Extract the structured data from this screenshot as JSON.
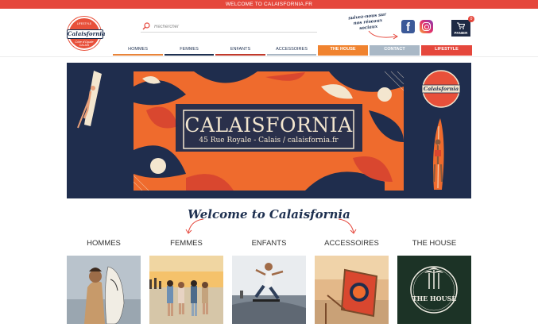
{
  "topbar": {
    "text": "WELCOME TO CALAISFORNIA.FR"
  },
  "logo": {
    "top": "LIFESTYLE",
    "name": "Calaisfornia",
    "sub": "Côte d'Opale",
    "bottom": "CALAIS"
  },
  "search": {
    "placeholder": "Rechercher"
  },
  "social": {
    "text": "suivez-nous sur nos réseaux sociaux",
    "facebook": "f"
  },
  "cart": {
    "label": "PANIER",
    "count": "0"
  },
  "nav": [
    {
      "label": "HOMMES",
      "color": "#e8843a",
      "style": "under"
    },
    {
      "label": "FEMMES",
      "color": "#1e3050",
      "style": "under"
    },
    {
      "label": "ENFANTS",
      "color": "#c0392b",
      "style": "under"
    },
    {
      "label": "ACCESSOIRES",
      "color": "#aab7c4",
      "style": "under"
    },
    {
      "label": "THE HOUSE",
      "color": "#f0832f",
      "style": "filled"
    },
    {
      "label": "CONTACT",
      "color": "#a9b8c6",
      "style": "filled"
    },
    {
      "label": "LIFESTYLE",
      "color": "#e5473c",
      "style": "filled"
    }
  ],
  "banner": {
    "title": "CALAISFORNIA",
    "subtitle": "45 Rue Royale - Calais / calaisfornia.fr",
    "logo_name": "Calaisfornia",
    "colors": {
      "navy": "#1f2d4d",
      "orange": "#ef6b2d",
      "red": "#d9472f",
      "cream": "#f3e6cf"
    }
  },
  "welcome": "Welcome to Calaisfornia",
  "categories": [
    {
      "label": "HOMMES",
      "image": "man-with-surfboard"
    },
    {
      "label": "FEMMES",
      "image": "women-on-beach"
    },
    {
      "label": "ENFANTS",
      "image": "kid-skateboarding"
    },
    {
      "label": "ACCESSOIRES",
      "image": "beach-deckchair"
    },
    {
      "label": "THE HOUSE",
      "image": "the-house-logo",
      "logo_text": "THE HOUSE"
    }
  ]
}
